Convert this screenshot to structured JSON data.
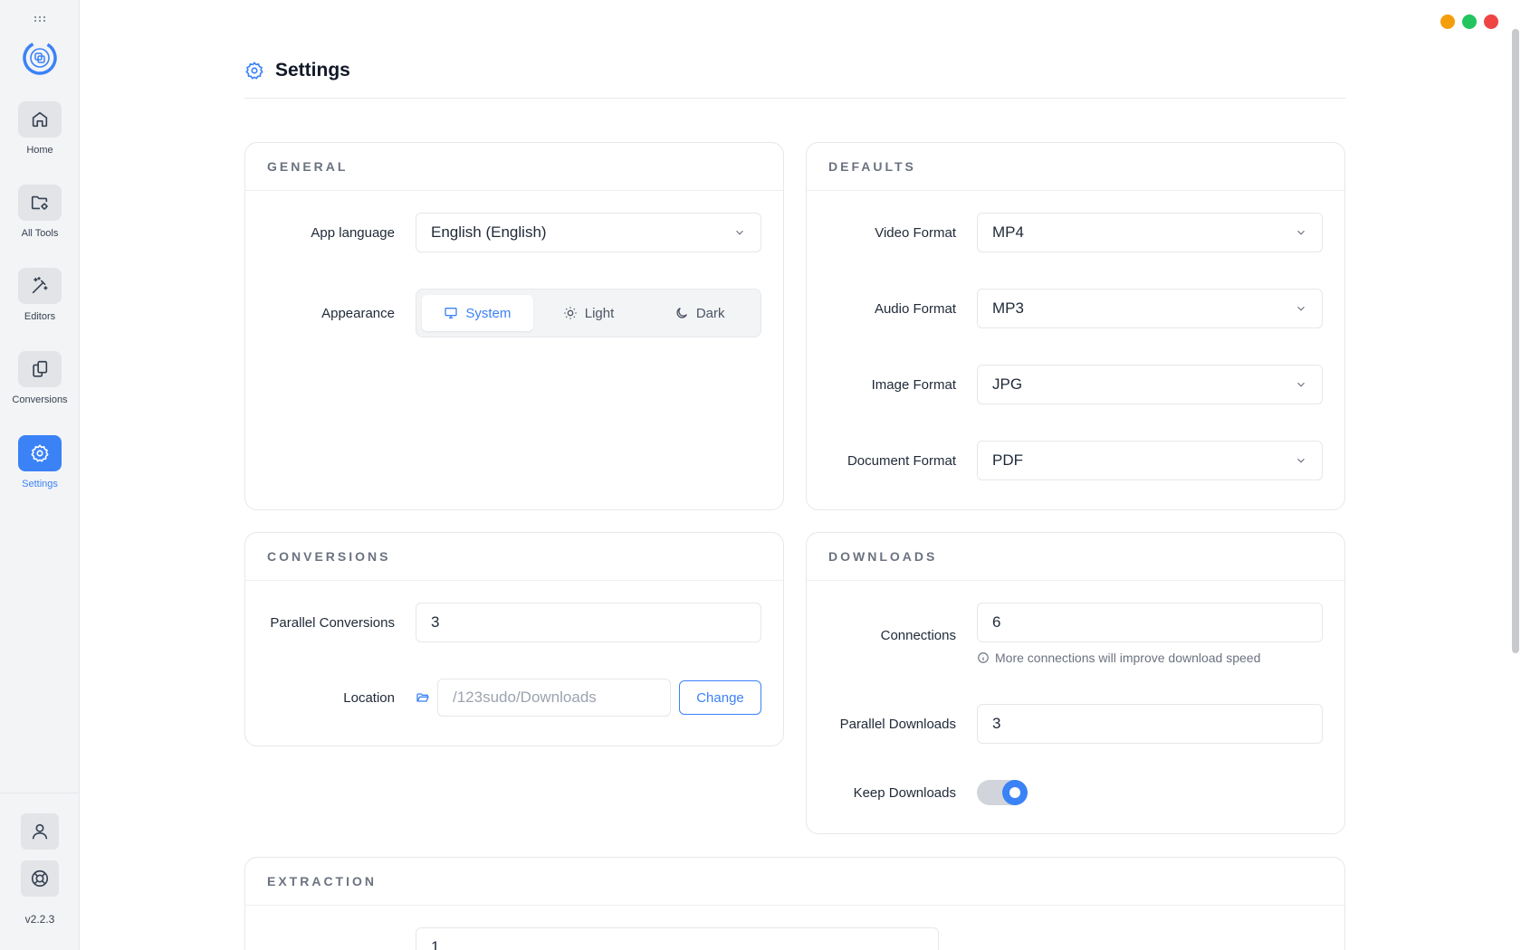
{
  "sidebar": {
    "items": [
      {
        "label": "Home",
        "icon": "home-icon"
      },
      {
        "label": "All Tools",
        "icon": "folder-gear-icon"
      },
      {
        "label": "Editors",
        "icon": "magic-wand-icon"
      },
      {
        "label": "Conversions",
        "icon": "copy-files-icon"
      },
      {
        "label": "Settings",
        "icon": "gear-icon",
        "active": true
      }
    ],
    "bottom": [
      {
        "icon": "user-icon"
      },
      {
        "icon": "lifebuoy-icon"
      }
    ],
    "version": "v2.2.3"
  },
  "window_controls": {
    "minimize": "#f59e0b",
    "maximize": "#22c55e",
    "close": "#ef4444"
  },
  "header": {
    "title": "Settings"
  },
  "general": {
    "title": "GENERAL",
    "language_label": "App language",
    "language_value": "English (English)",
    "appearance_label": "Appearance",
    "appearance_options": [
      "System",
      "Light",
      "Dark"
    ],
    "appearance_selected": "System"
  },
  "defaults": {
    "title": "DEFAULTS",
    "video_label": "Video Format",
    "video_value": "MP4",
    "audio_label": "Audio Format",
    "audio_value": "MP3",
    "image_label": "Image Format",
    "image_value": "JPG",
    "document_label": "Document Format",
    "document_value": "PDF"
  },
  "conversions": {
    "title": "CONVERSIONS",
    "parallel_label": "Parallel Conversions",
    "parallel_value": "3",
    "location_label": "Location",
    "location_placeholder": "/123sudo/Downloads",
    "change_label": "Change"
  },
  "downloads": {
    "title": "DOWNLOADS",
    "connections_label": "Connections",
    "connections_value": "6",
    "connections_hint": "More connections will improve download speed",
    "parallel_label": "Parallel Downloads",
    "parallel_value": "3",
    "keep_label": "Keep Downloads",
    "keep_value": true
  },
  "extraction": {
    "title": "EXTRACTION",
    "value": "1"
  },
  "colors": {
    "accent": "#3b82f6"
  }
}
